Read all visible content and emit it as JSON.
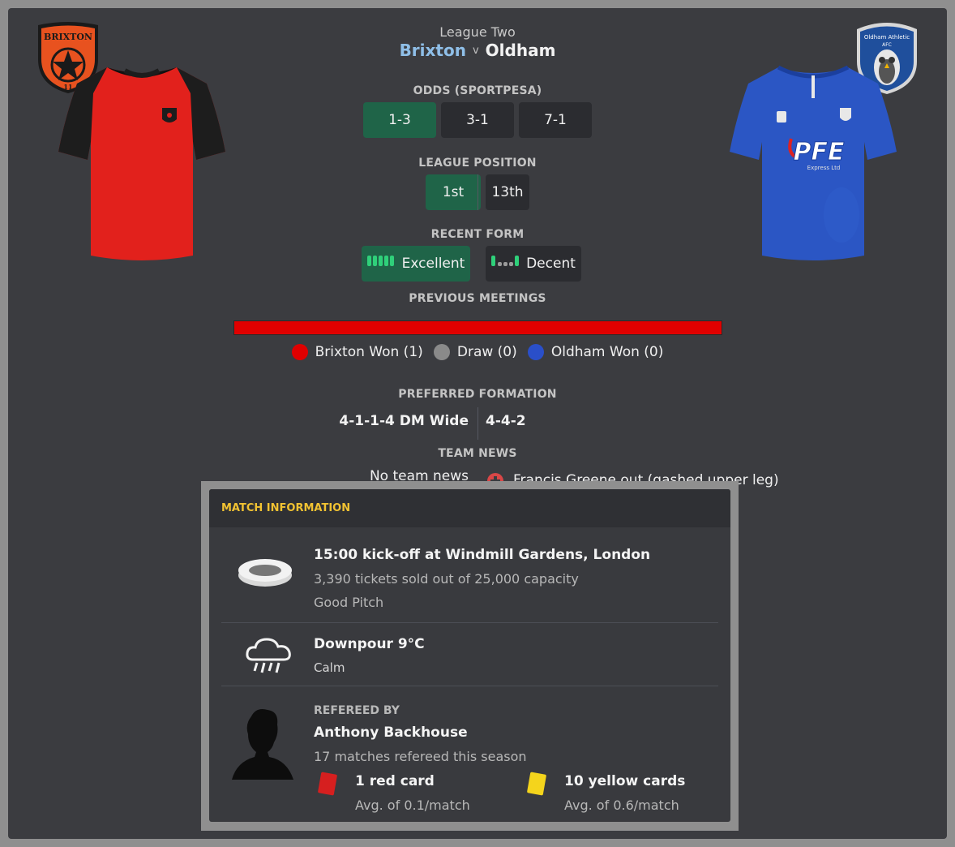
{
  "match": {
    "competition": "League Two",
    "home_team": "Brixton",
    "vs": "v",
    "away_team": "Oldham"
  },
  "home_badge": {
    "text_top": "BRIXTON",
    "text_bottom": "11",
    "color": "#e8521f"
  },
  "away_badge": {
    "text_top": "Oldham Athletic",
    "text_sub": "AFC"
  },
  "home_kit": {
    "primary": "#e2211c",
    "sleeves": "#1d1d1d"
  },
  "away_kit": {
    "primary": "#2b56c4",
    "sponsor": "PFE",
    "sponsor_sub": "Express Ltd"
  },
  "odds": {
    "label": "ODDS (SPORTPESA)",
    "values": [
      "1-3",
      "3-1",
      "7-1"
    ]
  },
  "league_position": {
    "label": "LEAGUE POSITION",
    "home": "1st",
    "away": "13th"
  },
  "recent_form": {
    "label": "RECENT FORM",
    "home": "Excellent",
    "away": "Decent"
  },
  "previous_meetings": {
    "label": "PREVIOUS MEETINGS",
    "home_won": "Brixton Won (1)",
    "draw": "Draw (0)",
    "away_won": "Oldham Won (0)",
    "colors": {
      "home": "#e00000",
      "draw": "#8a8a8a",
      "away": "#2a4fc9"
    }
  },
  "preferred_formation": {
    "label": "PREFERRED FORMATION",
    "home": "4-1-1-4 DM Wide",
    "away": "4-4-2"
  },
  "team_news": {
    "label": "TEAM NEWS",
    "home": "No team news",
    "away": "Francis Greene out (gashed upper leg)"
  },
  "match_information": {
    "title": "MATCH INFORMATION",
    "venue": {
      "headline": "15:00 kick-off at Windmill Gardens, London",
      "tickets": "3,390 tickets sold out of 25,000 capacity",
      "pitch": "Good Pitch",
      "icon": "stadium-icon"
    },
    "weather": {
      "headline": "Downpour 9°C",
      "wind": "Calm",
      "icon": "rain-cloud-icon"
    },
    "referee": {
      "label": "REFEREED BY",
      "name": "Anthony Backhouse",
      "matches": "17 matches refereed this season",
      "red_cards": "1 red card",
      "red_avg": "Avg. of 0.1/match",
      "yellow_cards": "10 yellow cards",
      "yellow_avg": "Avg. of 0.6/match",
      "icon": "referee-silhouette-icon"
    }
  }
}
